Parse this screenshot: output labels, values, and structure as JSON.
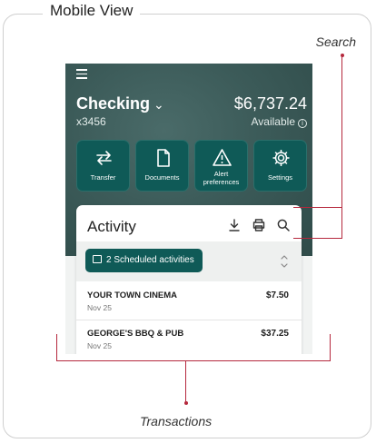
{
  "frame": {
    "label": "Mobile View"
  },
  "callouts": {
    "search": "Search",
    "transactions": "Transactions"
  },
  "account": {
    "name": "Checking",
    "number": "x3456",
    "balance": "$6,737.24",
    "available_label": "Available"
  },
  "actions": [
    {
      "label": "Transfer",
      "icon": "transfer-arrows-icon"
    },
    {
      "label": "Documents",
      "icon": "document-icon"
    },
    {
      "label": "Alert preferences",
      "icon": "warning-triangle-icon"
    },
    {
      "label": "Settings",
      "icon": "gear-icon"
    }
  ],
  "activity": {
    "title": "Activity",
    "tools": [
      "download-icon",
      "print-icon",
      "search-icon"
    ],
    "scheduled_label": "2 Scheduled activities",
    "transactions": [
      {
        "name": "YOUR TOWN CINEMA",
        "date": "Nov 25",
        "amount": "$7.50"
      },
      {
        "name": "GEORGE'S BBQ & PUB",
        "date": "Nov 25",
        "amount": "$37.25"
      }
    ]
  },
  "colors": {
    "header_bg": "#3c5b59",
    "action_bg": "#0f5a57",
    "callout_line": "#b5283d"
  }
}
